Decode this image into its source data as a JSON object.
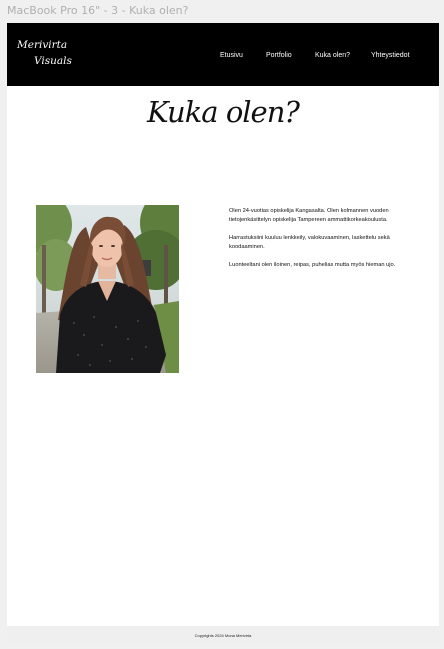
{
  "frame": {
    "label": "MacBook Pro 16\" - 3 - Kuka olen?"
  },
  "header": {
    "logo": {
      "line1": "Merivirta",
      "line2": "Visuals"
    },
    "nav": [
      {
        "label": "Etusivu"
      },
      {
        "label": "Portfolio"
      },
      {
        "label": "Kuka olen?"
      },
      {
        "label": "Yhteystiedot"
      }
    ]
  },
  "main": {
    "title": "Kuka olen?",
    "portrait_icon": "portrait-photo",
    "bio": [
      "Olen 24-vuotias opiskelija Kangasalta. Olen kolmannen vuoden tietojenkäsittelyn opiskelija Tampereen ammattikorkeakoulusta.",
      "Harrastuksiini kuuluu lenkkeily, valokuvaaminen, laskettelu sekä koodaaminen.",
      "Luonteeltani olen iloinen, reipas, puhelias mutta myös hieman ujo."
    ]
  },
  "footer": {
    "copyright": "Copyrights 2024 Mona Merivirta"
  },
  "colors": {
    "header_bg": "#000000",
    "page_bg": "#ffffff",
    "footer_bg": "#efefef",
    "canvas_bg": "#f0f0f0"
  }
}
